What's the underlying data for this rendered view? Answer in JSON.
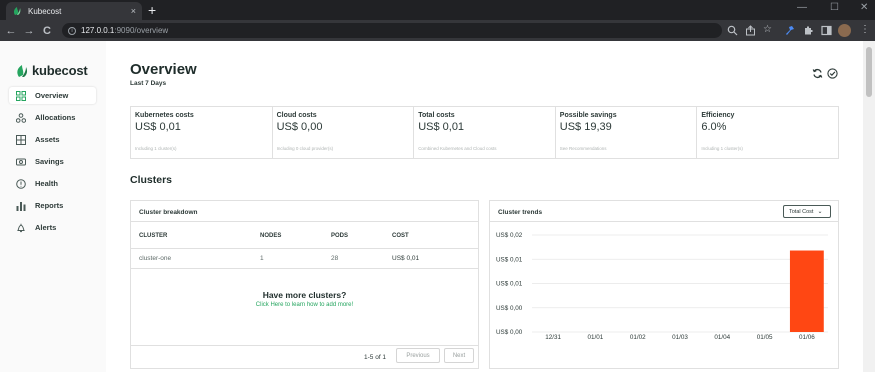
{
  "browser": {
    "tab_title": "Kubecost",
    "tab_close": "×",
    "new_tab": "+",
    "url_host": "127.0.0.1",
    "url_path": ":9090/overview",
    "back": "←",
    "forward": "→",
    "reload": "C"
  },
  "sidebar": {
    "logo_text": "kubecost",
    "items": [
      {
        "label": "Overview",
        "icon": "grid-icon",
        "active": true
      },
      {
        "label": "Allocations",
        "icon": "allocations-icon"
      },
      {
        "label": "Assets",
        "icon": "assets-icon"
      },
      {
        "label": "Savings",
        "icon": "savings-icon"
      },
      {
        "label": "Health",
        "icon": "health-icon"
      },
      {
        "label": "Reports",
        "icon": "reports-icon"
      },
      {
        "label": "Alerts",
        "icon": "bell-icon"
      }
    ]
  },
  "header": {
    "title": "Overview",
    "subtitle": "Last 7 Days"
  },
  "stats": [
    {
      "label": "Kubernetes costs",
      "value": "US$ 0,01",
      "note": "Including 1 cluster(s)"
    },
    {
      "label": "Cloud costs",
      "value": "US$ 0,00",
      "note": "Including 0 cloud provider(s)"
    },
    {
      "label": "Total costs",
      "value": "US$ 0,01",
      "note": "Combined Kubernetes and Cloud costs"
    },
    {
      "label": "Possible savings",
      "value": "US$ 19,39",
      "note": "See Recommendations"
    },
    {
      "label": "Efficiency",
      "value": "6.0%",
      "note": "Including 1 cluster(s)"
    }
  ],
  "clusters_title": "Clusters",
  "breakdown": {
    "title": "Cluster breakdown",
    "columns": [
      "CLUSTER",
      "NODES",
      "PODS",
      "COST"
    ],
    "rows": [
      {
        "cluster": "cluster-one",
        "nodes": "1",
        "pods": "28",
        "cost": "US$ 0,01"
      }
    ],
    "more_title": "Have more clusters?",
    "more_link": "Click Here to learn how to add more!",
    "pager_text": "1-5 of 1",
    "prev_label": "Previous",
    "next_label": "Next"
  },
  "trends": {
    "title": "Cluster trends",
    "select_label": "Total Cost",
    "select_caret": "⌄"
  },
  "chart_data": {
    "type": "bar",
    "categories": [
      "12/31",
      "01/01",
      "01/02",
      "01/03",
      "01/04",
      "01/05",
      "01/06"
    ],
    "values": [
      0,
      0,
      0,
      0,
      0,
      0,
      0.0168
    ],
    "ytick_labels": [
      "US$ 0,02",
      "US$ 0,01",
      "US$ 0,01",
      "US$ 0,00",
      "US$ 0,00"
    ],
    "ylim": [
      0,
      0.02
    ],
    "grid": true,
    "bar_color": "#ff4713"
  },
  "colors": {
    "brand_green": "#25a55f",
    "bar": "#ff4713"
  }
}
